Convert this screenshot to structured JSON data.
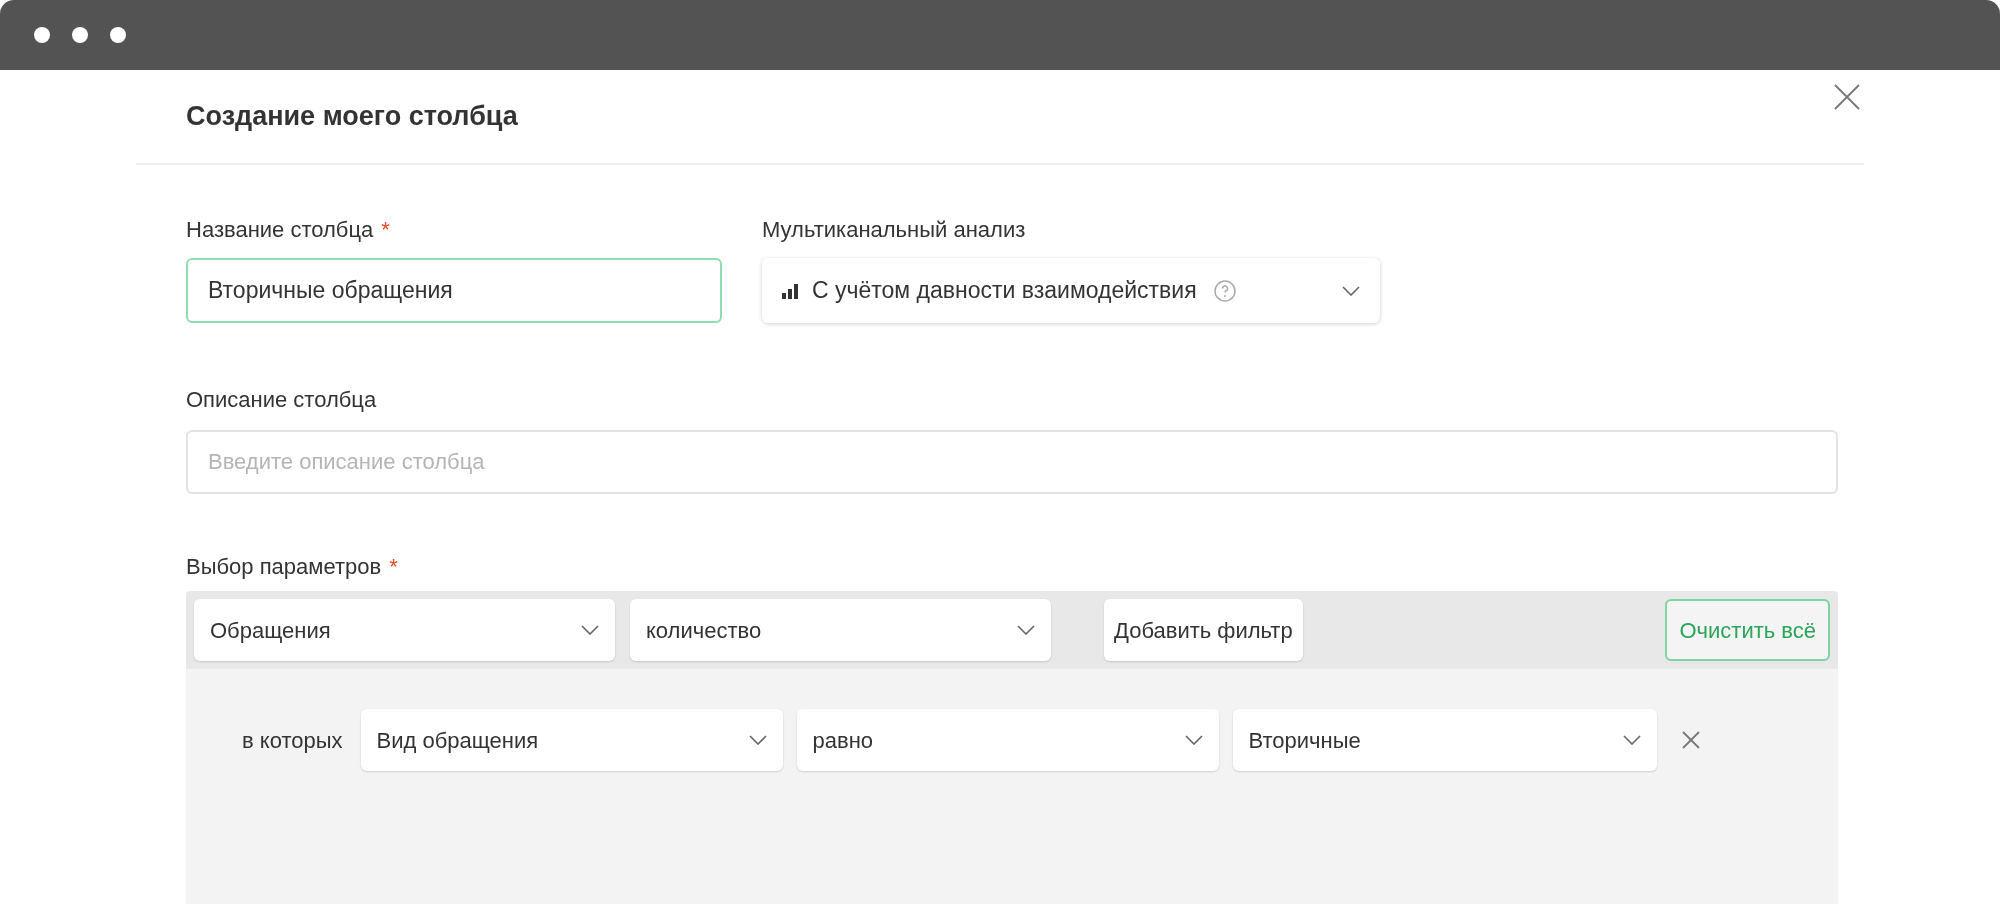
{
  "window": {
    "title": "Создание моего столбца"
  },
  "name_field": {
    "label": "Название столбца",
    "required_mark": "*",
    "value": "Вторичные обращения",
    "focused": true
  },
  "multichannel": {
    "label": "Мультиканальный анализ",
    "value": "С учётом давности взаимодействия"
  },
  "description_field": {
    "label": "Описание столбца",
    "placeholder": "Введите описание столбца"
  },
  "parameters": {
    "label": "Выбор параметров",
    "required_mark": "*",
    "selects": [
      {
        "value": "Обращения"
      },
      {
        "value": "количество"
      }
    ],
    "add_filter": "Добавить фильтр",
    "clear_all": "Очистить всё",
    "filters": [
      {
        "prefix": "в которых",
        "field": "Вид обращения",
        "operator": "равно",
        "value": "Вторичные"
      }
    ]
  }
}
